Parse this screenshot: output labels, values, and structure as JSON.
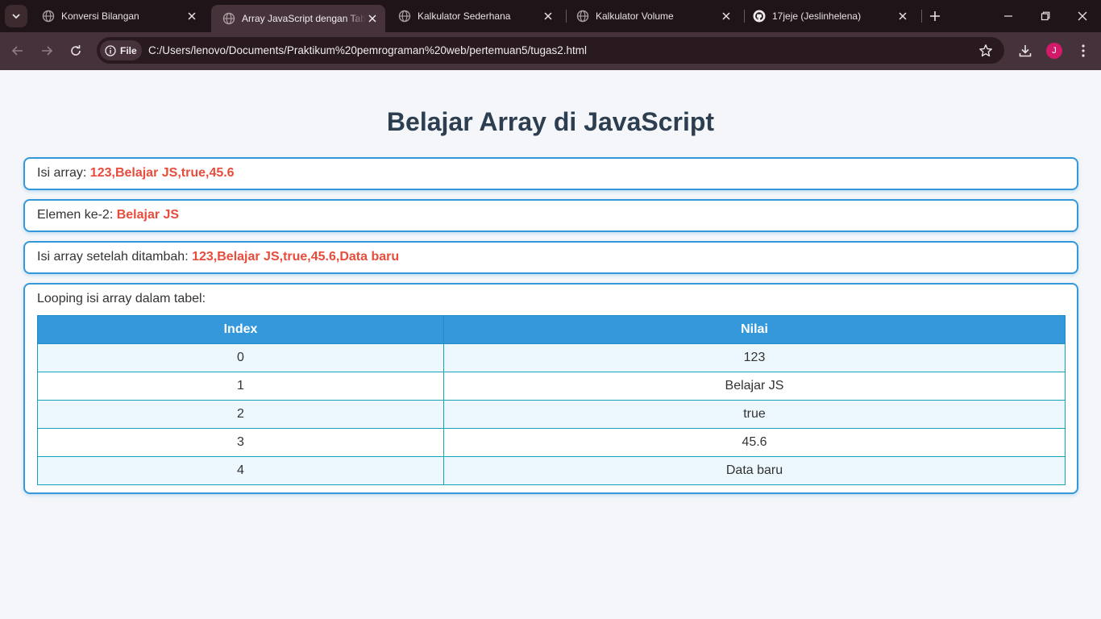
{
  "browser": {
    "tabs": [
      {
        "title": "Konversi Bilangan",
        "icon": "globe-icon",
        "active": false
      },
      {
        "title": "Array JavaScript dengan Tabel",
        "icon": "globe-icon",
        "active": true
      },
      {
        "title": "Kalkulator Sederhana",
        "icon": "globe-icon",
        "active": false
      },
      {
        "title": "Kalkulator Volume",
        "icon": "globe-icon",
        "active": false
      },
      {
        "title": "17jeje (Jeslinhelena)",
        "icon": "github-icon",
        "active": false
      }
    ],
    "chip_label": "File",
    "url": "C:/Users/lenovo/Documents/Praktikum%20pemrograman%20web/pertemuan5/tugas2.html",
    "avatar_letter": "J",
    "accent": "#3498db",
    "highlight": "#e74c3c"
  },
  "page": {
    "title": "Belajar Array di JavaScript",
    "box1": {
      "label": "Isi array: ",
      "value": "123,Belajar JS,true,45.6"
    },
    "box2": {
      "label": "Elemen ke-2: ",
      "value": "Belajar JS"
    },
    "box3": {
      "label": "Isi array setelah ditambah: ",
      "value": "123,Belajar JS,true,45.6,Data baru"
    },
    "box4": {
      "label": "Looping isi array dalam tabel:",
      "headers": [
        "Index",
        "Nilai"
      ],
      "rows": [
        {
          "index": "0",
          "value": "123"
        },
        {
          "index": "1",
          "value": "Belajar JS"
        },
        {
          "index": "2",
          "value": "true"
        },
        {
          "index": "3",
          "value": "45.6"
        },
        {
          "index": "4",
          "value": "Data baru"
        }
      ]
    }
  }
}
